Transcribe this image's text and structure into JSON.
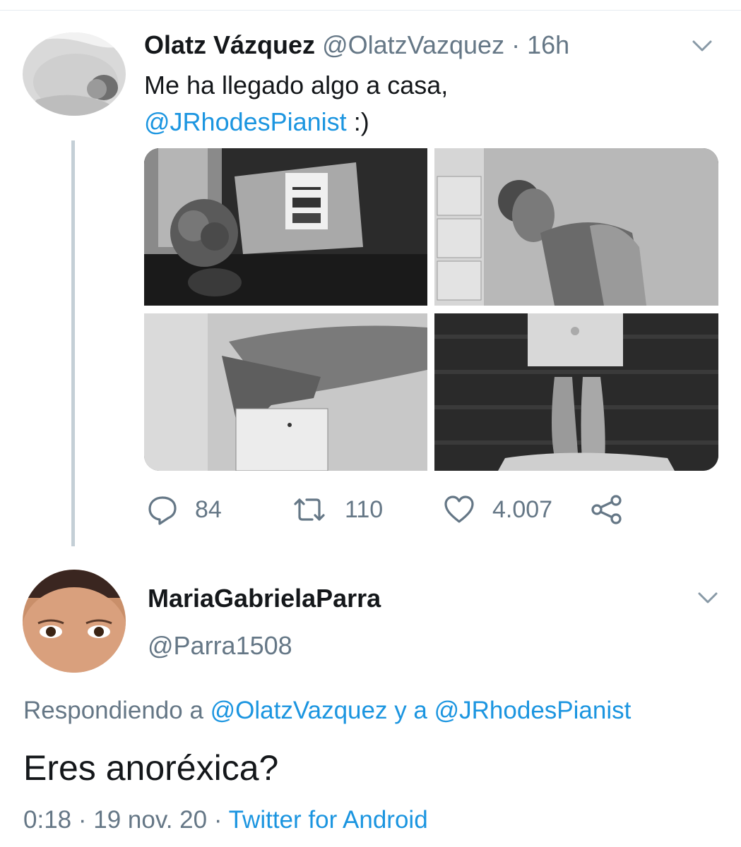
{
  "tweet": {
    "name": "Olatz Vázquez",
    "handle": "@OlatzVazquez",
    "separator": "·",
    "time": "16h",
    "text_line1": "Me ha llegado algo a casa,",
    "text_mention": "@JRhodesPianist",
    "text_suffix": " :)",
    "photos": [
      "parcel-box-photo",
      "woman-portrait-photo",
      "hand-on-box-photo",
      "feet-and-laptop-photo"
    ],
    "actions": {
      "replies": "84",
      "retweets": "110",
      "likes": "4.007"
    }
  },
  "reply": {
    "name": "MariaGabrielaParra",
    "handle": "@Parra1508",
    "replying_prefix": "Respondiendo a ",
    "replying_to_1": "@OlatzVazquez",
    "replying_conj": " y a ",
    "replying_to_2": "@JRhodesPianist",
    "text": "Eres anoréxica?",
    "time": "0:18",
    "sep1": " · ",
    "date": "19 nov. 20",
    "sep2": " · ",
    "source": "Twitter for Android"
  },
  "colors": {
    "link": "#1b95e0",
    "secondary_text": "#657786",
    "primary_text": "#14171a",
    "thread_line": "#c4cfd6"
  }
}
